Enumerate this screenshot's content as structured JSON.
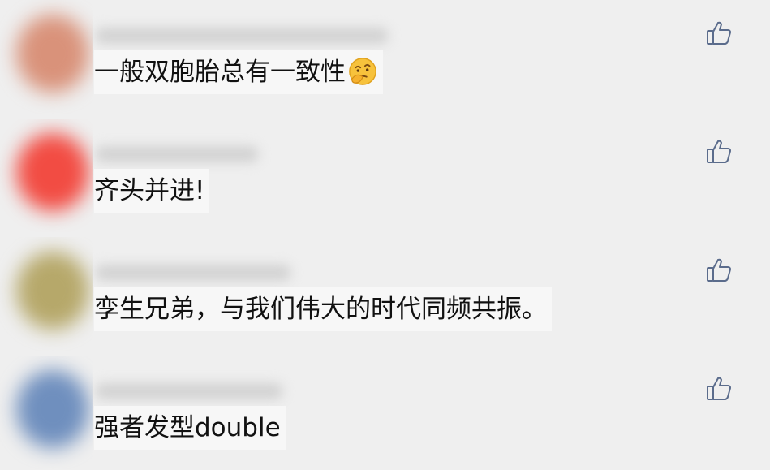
{
  "comments": [
    {
      "text": "一般双胞胎总有一致性",
      "emoji": "thinking-face-emoji",
      "avatar_color": "#d9927a"
    },
    {
      "text": "齐头并进!",
      "avatar_color": "#f24c43"
    },
    {
      "text": "孪生兄弟，与我们伟大的时代同频共振。",
      "avatar_color": "#b6a86a"
    },
    {
      "text": "强者发型double",
      "avatar_color": "#6f8fbe"
    }
  ],
  "icons": {
    "like": "thumbs-up-icon"
  },
  "colors": {
    "background": "#efefef",
    "like_icon": "#5b6c8c",
    "text": "#111111"
  }
}
